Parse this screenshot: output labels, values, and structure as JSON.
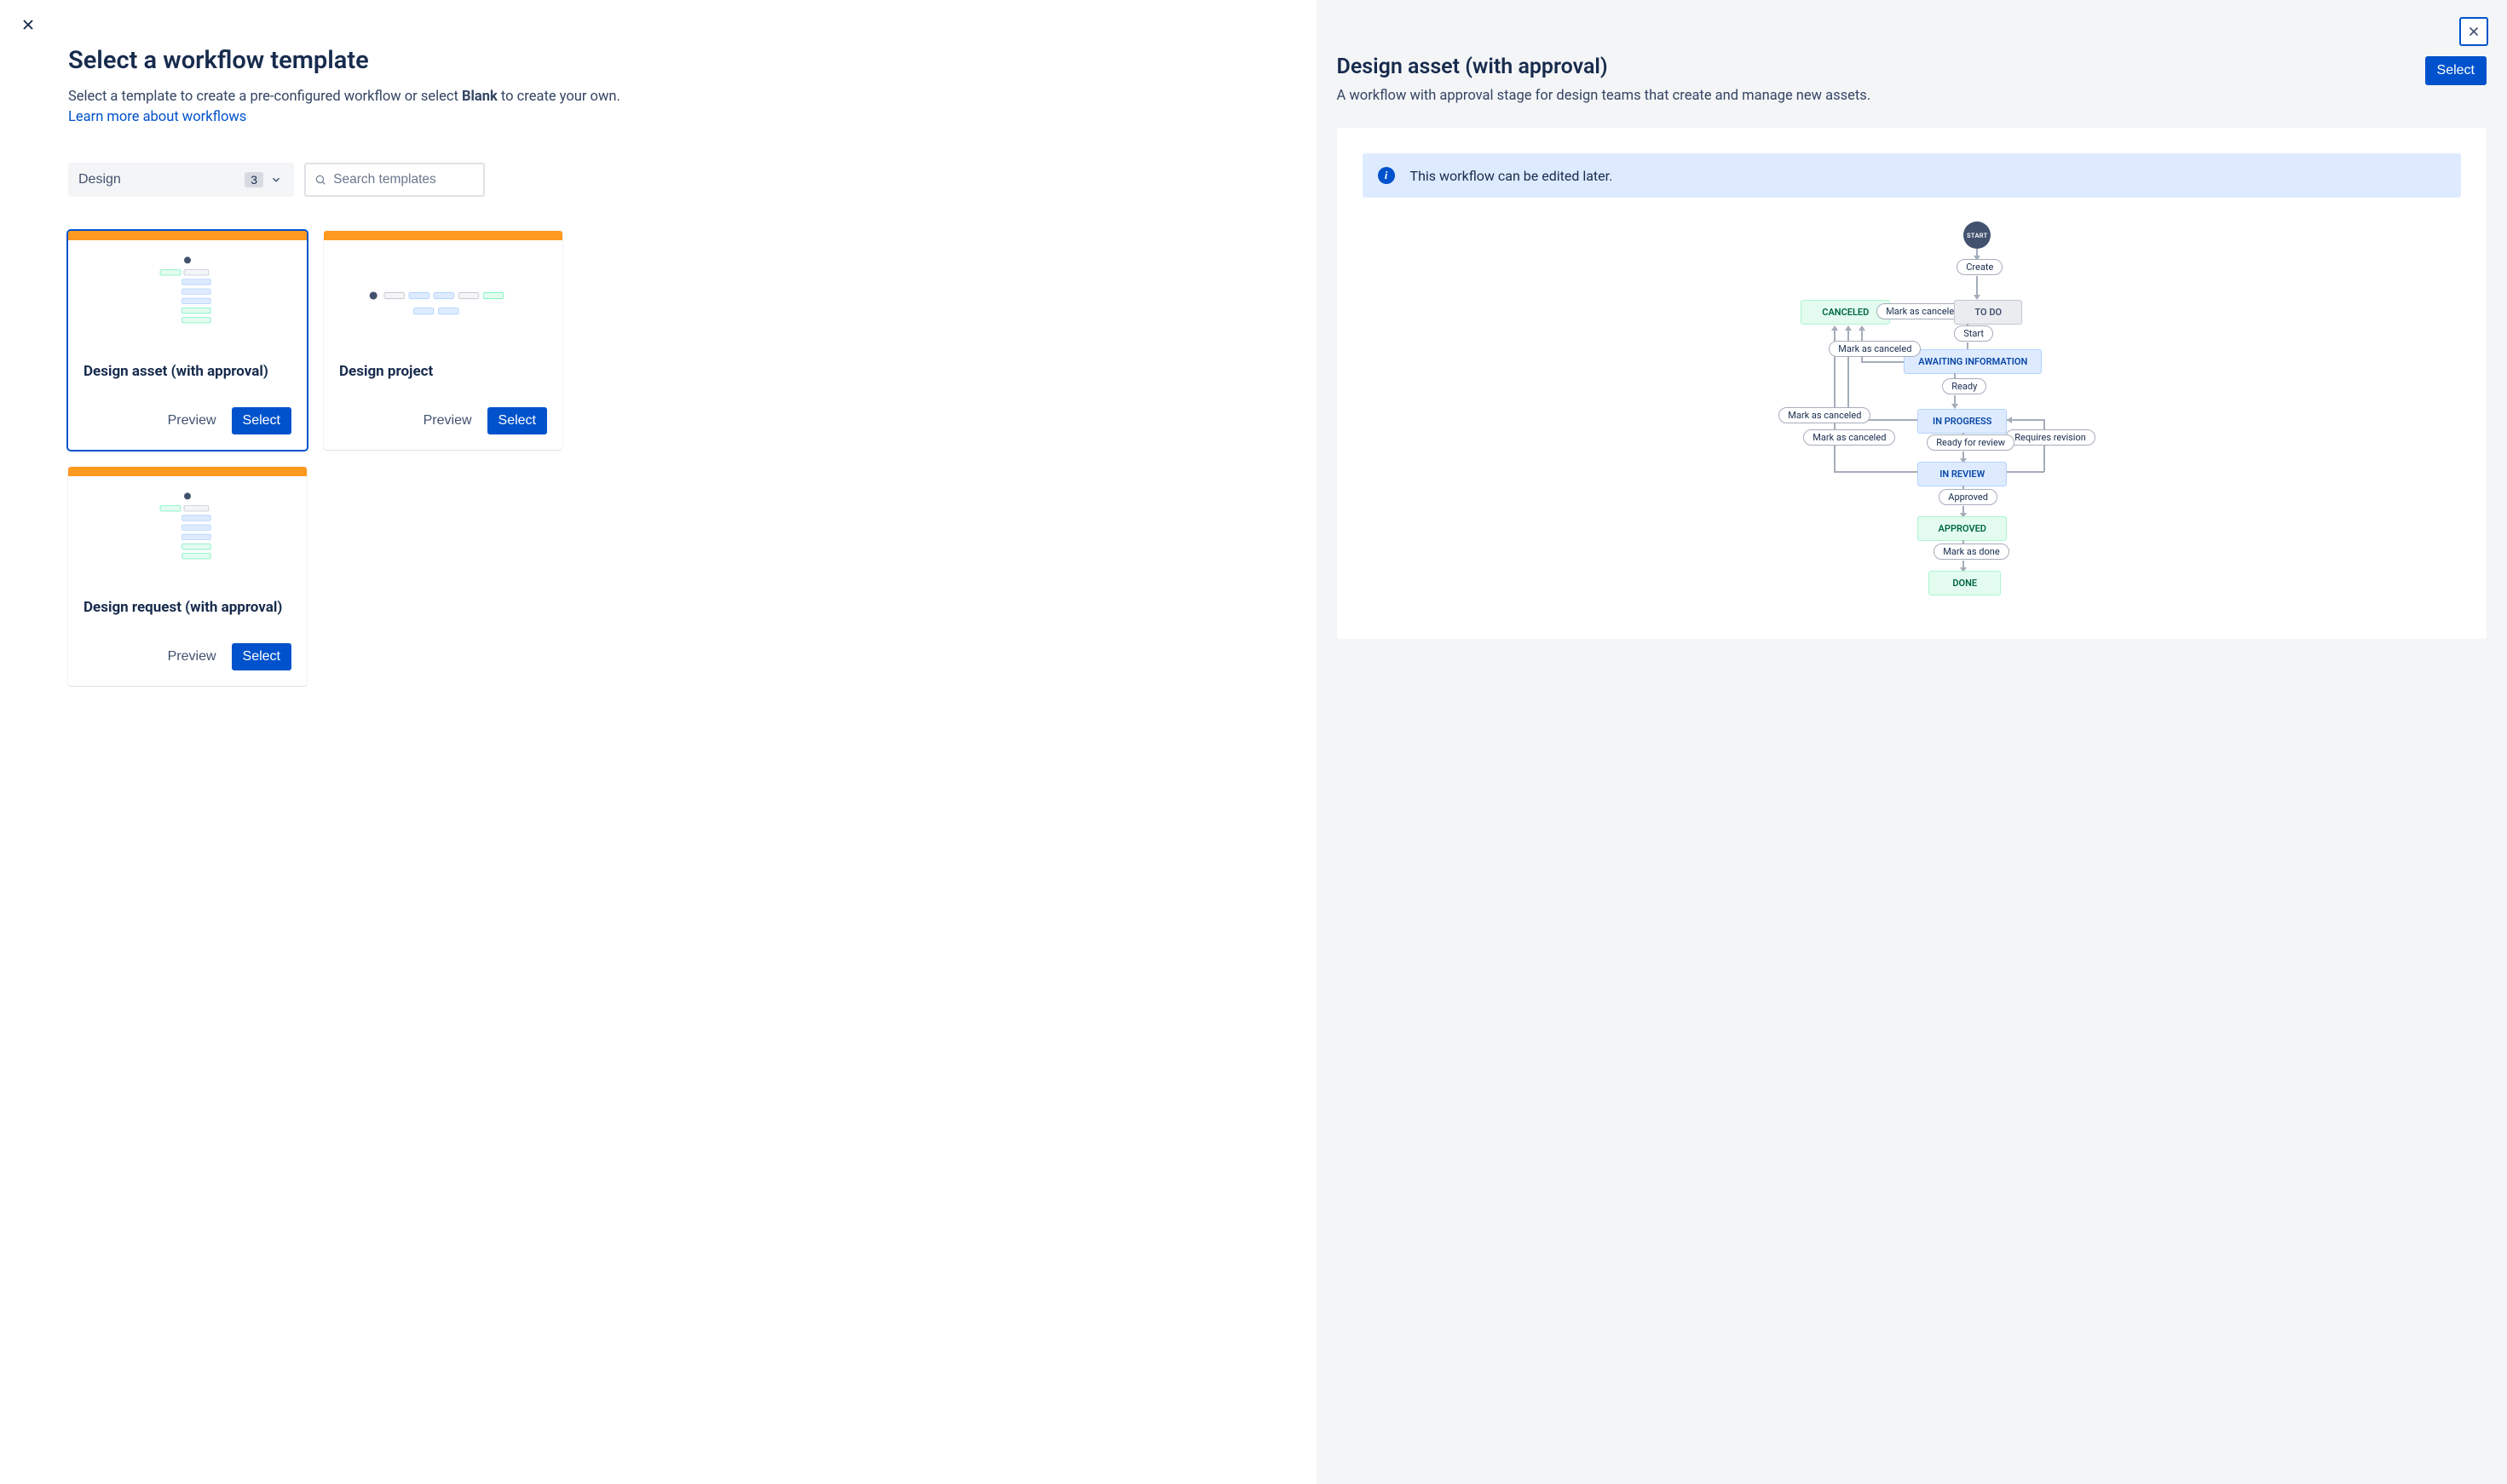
{
  "left": {
    "title": "Select a workflow template",
    "description_pre": "Select a template to create a pre-configured workflow or select ",
    "description_bold": "Blank",
    "description_post": " to create your own.",
    "learn_link": "Learn more about workflows",
    "filter": {
      "category": "Design",
      "count": "3"
    },
    "search": {
      "placeholder": "Search templates"
    },
    "cards": [
      {
        "title": "Design asset (with approval)",
        "preview_label": "Preview",
        "select_label": "Select",
        "selected": true
      },
      {
        "title": "Design project",
        "preview_label": "Preview",
        "select_label": "Select",
        "selected": false
      },
      {
        "title": "Design request (with approval)",
        "preview_label": "Preview",
        "select_label": "Select",
        "selected": false
      }
    ]
  },
  "right": {
    "title": "Design asset (with approval)",
    "description": "A workflow with approval stage for design teams that create and manage new assets.",
    "select_label": "Select",
    "info_message": "This workflow can be edited later.",
    "workflow": {
      "start": "START",
      "statuses": {
        "canceled": "CANCELED",
        "todo": "TO DO",
        "awaiting": "AWAITING INFORMATION",
        "in_progress": "IN PROGRESS",
        "in_review": "IN REVIEW",
        "approved": "APPROVED",
        "done": "DONE"
      },
      "transitions": {
        "create": "Create",
        "mark_canceled": "Mark as canceled",
        "start": "Start",
        "ready": "Ready",
        "ready_for_review": "Ready for review",
        "requires_revision": "Requires revision",
        "approved": "Approved",
        "mark_done": "Mark as done"
      }
    }
  }
}
